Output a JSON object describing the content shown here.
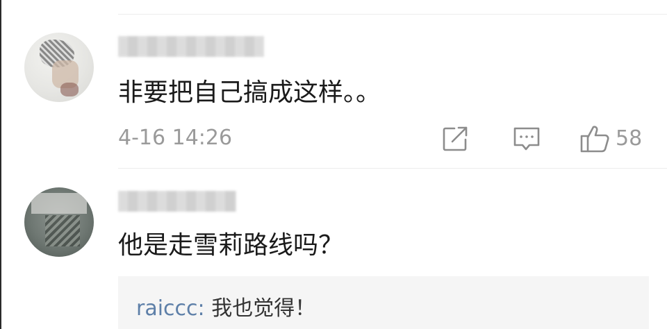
{
  "comments": [
    {
      "avatar_icon": "user-avatar-icon",
      "text": "非要把自己搞成这样。。",
      "timestamp": "4-16 14:26",
      "actions": {
        "share_icon": "share-icon",
        "reply_icon": "comment-icon",
        "like_icon": "thumbs-up-icon",
        "like_count": "58"
      }
    },
    {
      "avatar_icon": "user-avatar-icon",
      "text": "他是走雪莉路线吗？",
      "reply": {
        "username": "raiccc:",
        "text": " 我也觉得！"
      }
    }
  ],
  "colors": {
    "text_primary": "#1a1a1a",
    "text_secondary": "#9a9a9a",
    "reply_username": "#5d7fa8",
    "reply_background": "#f5f5f5",
    "icon_gray": "#8c8c8c"
  }
}
